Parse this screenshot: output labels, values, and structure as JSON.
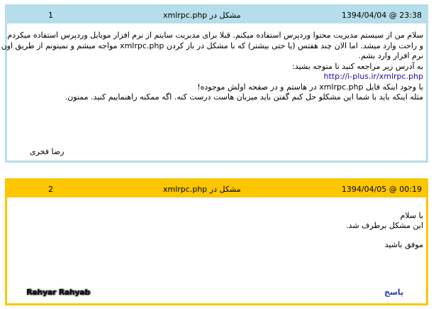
{
  "posts": [
    {
      "number": "1",
      "subject": "مشکل در xmlrpc.php",
      "date": "1394/04/04 @ 23:38",
      "lines": [
        "سلام من از سیستم مدیریت محتوا وردپرس استفاده میکنم. قبلا برای مدیریت سایتم از نرم افزار موبایل وردپرس استفاده میکردم",
        "و راحت وارد میشد. اما الان چند هفتس (یا حتی بیشتر) که با مشکل در باز کردن xmlrpc.php مواجه میشم و نمیتونم از طریق اون",
        "نرم افزار وارد بشم.",
        "به آدرس زیر مراجعه کنید تا متوجه بشید:",
        "http://i-plus.ir/xmlrpc.php",
        "با وجود اینکه فایل xmlrpc.php در هاستم و در صفحه اولش موجوده!",
        "مثله اینکه باید با شما این مشکلو حل کنم گفتن باید میزبان هاست درست کنه. اگه ممکنه راهنماییم کنید. ممنون."
      ],
      "signature": "رضا فخری"
    },
    {
      "number": "2",
      "subject": "مشکل در xmlrpc.php",
      "date": "1394/04/05 @ 00:19",
      "lines": [
        "با سلام",
        "این مشکل برطرف شد.",
        "",
        "موفق باشید"
      ],
      "signature": "Rahyar Rahyab",
      "reply_label": "پاسخ"
    }
  ],
  "colors": {
    "post1_header": "#b6ddea",
    "post2_header": "#fcc600",
    "link": "#1a0dab",
    "reply": "#1e3fb0"
  }
}
